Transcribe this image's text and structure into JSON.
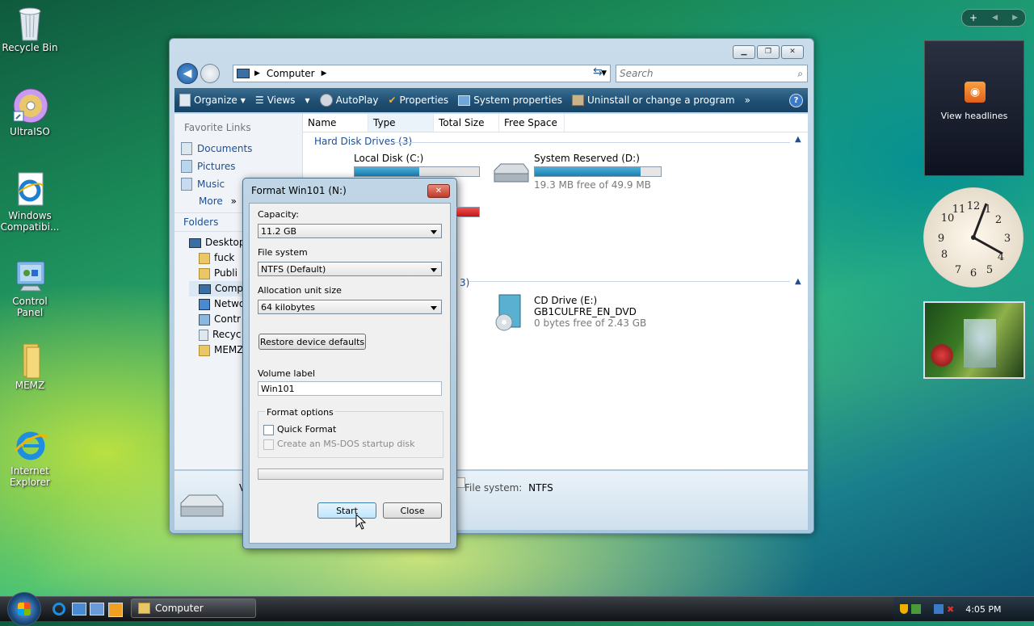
{
  "desktop": {
    "icons": [
      {
        "label": "Recycle Bin"
      },
      {
        "label": "UltraISO"
      },
      {
        "label": "Windows Compatibi..."
      },
      {
        "label": "Control Panel"
      },
      {
        "label": "MEMZ"
      },
      {
        "label": "Internet Explorer"
      }
    ]
  },
  "explorer": {
    "address": "Computer",
    "search_placeholder": "Search",
    "toolbar": {
      "organize": "Organize",
      "views": "Views",
      "autoplay": "AutoPlay",
      "properties": "Properties",
      "system_properties": "System properties",
      "uninstall": "Uninstall or change a program",
      "more": "»"
    },
    "favorite_links_title": "Favorite Links",
    "favorite_links": [
      "Documents",
      "Pictures",
      "Music",
      "More"
    ],
    "folders_title": "Folders",
    "folders": [
      "Desktop",
      "fuck",
      "Publi",
      "Comp",
      "Netwo",
      "Contr",
      "Recyc",
      "MEMZ"
    ],
    "columns": [
      "Name",
      "Type",
      "Total Size",
      "Free Space"
    ],
    "group_hdd": "Hard Disk Drives (3)",
    "group_removable_suffix": "3)",
    "drives": {
      "c": {
        "name": "Local Disk (C:)",
        "fill": 0.52
      },
      "d": {
        "name": "System Reserved (D:)",
        "fill": 0.84,
        "free": "19.3 MB free of 49.9 MB"
      },
      "e": {
        "name": "CD Drive (E:)",
        "label": "GB1CULFRE_EN_DVD",
        "free": "0 bytes free of 2.43 GB"
      }
    },
    "details": {
      "filesystem_label": "File system:",
      "filesystem_value": "NTFS",
      "prefix_char": "V"
    }
  },
  "dialog": {
    "title": "Format Win101 (N:)",
    "capacity_label": "Capacity:",
    "capacity_value": "11.2 GB",
    "filesystem_label": "File system",
    "filesystem_value": "NTFS (Default)",
    "alloc_label": "Allocation unit size",
    "alloc_value": "64 kilobytes",
    "restore_button": "Restore device defaults",
    "volume_label": "Volume label",
    "volume_value": "Win101",
    "format_options": "Format options",
    "quick_format": "Quick Format",
    "msdos": "Create an MS-DOS startup disk",
    "start": "Start",
    "close": "Close"
  },
  "taskbar": {
    "task": "Computer",
    "clock": "4:05 PM"
  },
  "gadgets": {
    "feed": "View headlines"
  },
  "colors": {
    "toolbar": "#1f4f72",
    "link": "#1d4f91"
  }
}
